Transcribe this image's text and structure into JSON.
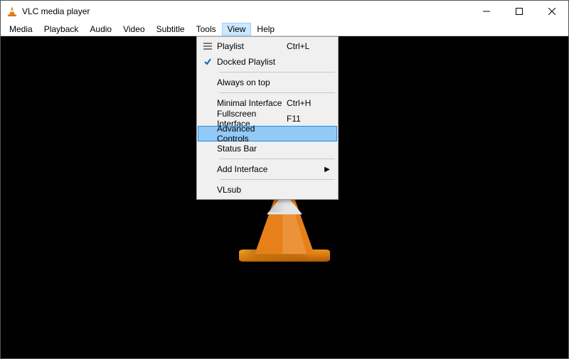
{
  "window": {
    "title": "VLC media player"
  },
  "menubar": {
    "items": [
      {
        "label": "Media"
      },
      {
        "label": "Playback"
      },
      {
        "label": "Audio"
      },
      {
        "label": "Video"
      },
      {
        "label": "Subtitle"
      },
      {
        "label": "Tools"
      },
      {
        "label": "View",
        "open": true
      },
      {
        "label": "Help"
      }
    ]
  },
  "view_menu": {
    "items": [
      {
        "label": "Playlist",
        "accel": "Ctrl+L",
        "icon": "playlist"
      },
      {
        "label": "Docked Playlist",
        "accel": "",
        "checked": true
      },
      {
        "sep": true
      },
      {
        "label": "Always on top",
        "accel": ""
      },
      {
        "sep": true
      },
      {
        "label": "Minimal Interface",
        "accel": "Ctrl+H"
      },
      {
        "label": "Fullscreen Interface",
        "accel": "F11"
      },
      {
        "label": "Advanced Controls",
        "accel": "",
        "highlight": true
      },
      {
        "label": "Status Bar",
        "accel": ""
      },
      {
        "sep": true
      },
      {
        "label": "Add Interface",
        "accel": "",
        "submenu": true
      },
      {
        "sep": true
      },
      {
        "label": "VLsub",
        "accel": ""
      }
    ]
  },
  "icons": {
    "submenu_arrow": "▶"
  }
}
